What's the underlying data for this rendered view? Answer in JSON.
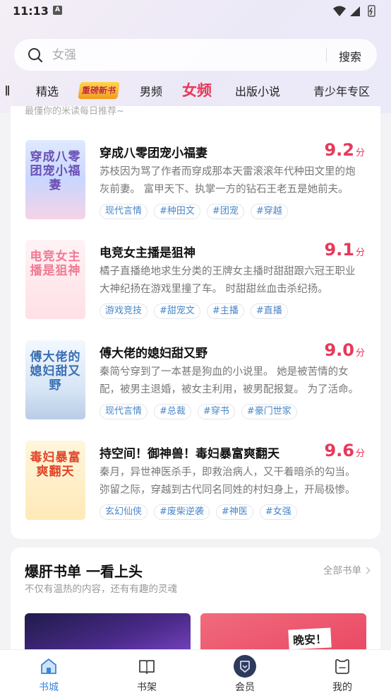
{
  "status_bar": {
    "time": "11:13",
    "notification_letter": "A"
  },
  "search": {
    "placeholder": "女强",
    "button_label": "搜索"
  },
  "tabs": [
    {
      "label": "精选"
    },
    {
      "label": "重磅新书",
      "style": "badge"
    },
    {
      "label": "男频"
    },
    {
      "label": "女频",
      "active": true
    },
    {
      "label": "出版小说"
    },
    {
      "label": "青少年专区"
    }
  ],
  "recommend": {
    "subtitle": "最懂你的米读每日推荐~",
    "books": [
      {
        "title": "穿成八零团宠小福妻",
        "score": "9.2",
        "score_unit": "分",
        "desc": "苏枝因为骂了作者而穿成那本天雷滚滚年代种田文里的炮灰前妻。 富甲天下、执掌一方的钻石王老五是她前夫。",
        "tags": [
          "现代言情",
          "#种田文",
          "#团宠",
          "#穿越"
        ],
        "cover_text": "穿成八零团宠小福妻"
      },
      {
        "title": "电竞女主播是狙神",
        "score": "9.1",
        "score_unit": "分",
        "desc": "橘子直播绝地求生分类的王牌女主播时甜甜跟六冠王职业大神纪扬在游戏里撞了车。 时甜甜丝血击杀纪扬。",
        "tags": [
          "游戏竞技",
          "#甜宠文",
          "#主播",
          "#直播"
        ],
        "cover_text": "电竞女主播是狙神"
      },
      {
        "title": "傅大佬的媳妇甜又野",
        "score": "9.0",
        "score_unit": "分",
        "desc": "秦简兮穿到了一本甚是狗血的小说里。 她是被苦情的女配，被男主退婚，被女主利用，被男配报复。 为了活命。",
        "tags": [
          "现代言情",
          "#总裁",
          "#穿书",
          "#豪门世家"
        ],
        "cover_text": "傅大佬的媳妇甜又野"
      },
      {
        "title": "持空间！御神兽！毒妇暴富爽翻天",
        "score": "9.6",
        "score_unit": "分",
        "desc": "秦月，异世神医杀手，即救治病人，又干着暗杀的勾当。 弥留之际，穿越到古代同名同姓的村妇身上，开局极惨。",
        "tags": [
          "玄幻仙侠",
          "#废柴逆袭",
          "#神医",
          "#女强"
        ],
        "cover_text": "毒妇暴富爽翻天"
      }
    ]
  },
  "booklist": {
    "title": "爆肝书单 一看上头",
    "subtitle": "不仅有温热的内容，还有有趣的灵魂",
    "all_label": "全部书单",
    "cover2_text": "晚安！"
  },
  "bottom_nav": [
    {
      "label": "书城",
      "active": true
    },
    {
      "label": "书架"
    },
    {
      "label": "会员"
    },
    {
      "label": "我的"
    }
  ],
  "colors": {
    "accent": "#e8395a",
    "nav_active": "#3d85d8",
    "tag_text": "#4a86c8"
  }
}
